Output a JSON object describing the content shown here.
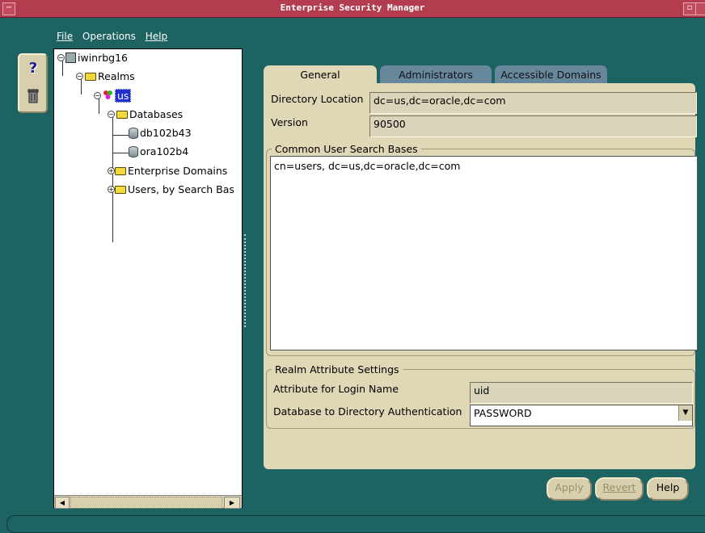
{
  "window": {
    "title": "Enterprise Security Manager"
  },
  "menu": [
    "File",
    "Operations",
    "Help"
  ],
  "toolbar": {
    "help_glyph": "?",
    "delete_icon": "trash-icon"
  },
  "tree": {
    "root": "iwinrbg16",
    "realms": "Realms",
    "realm_us": "us",
    "databases": "Databases",
    "db1": "db102b43",
    "db2": "ora102b4",
    "enterprise_domains": "Enterprise Domains",
    "users": "Users, by Search Bas"
  },
  "tabs": {
    "general": "General",
    "administrators": "Administrators",
    "accessible_domains": "Accessible Domains"
  },
  "general": {
    "directory_location_label": "Directory Location",
    "directory_location_value": "dc=us,dc=oracle,dc=com",
    "version_label": "Version",
    "version_value": "90500",
    "search_bases_legend": "Common User Search Bases",
    "search_bases_value": "cn=users, dc=us,dc=oracle,dc=com",
    "realm_attr_legend": "Realm Attribute Settings",
    "login_name_label": "Attribute for Login Name",
    "login_name_value": "uid",
    "db_auth_label": "Database to Directory Authentication",
    "db_auth_value": "PASSWORD"
  },
  "buttons": {
    "apply": "Apply",
    "revert": "Revert",
    "help": "Help"
  },
  "colors": {
    "background": "#1d6361",
    "titlebar": "#b33d4f",
    "panel": "#dfd7b6",
    "inactive_tab": "#67879c",
    "selection": "#1f2fd0"
  }
}
